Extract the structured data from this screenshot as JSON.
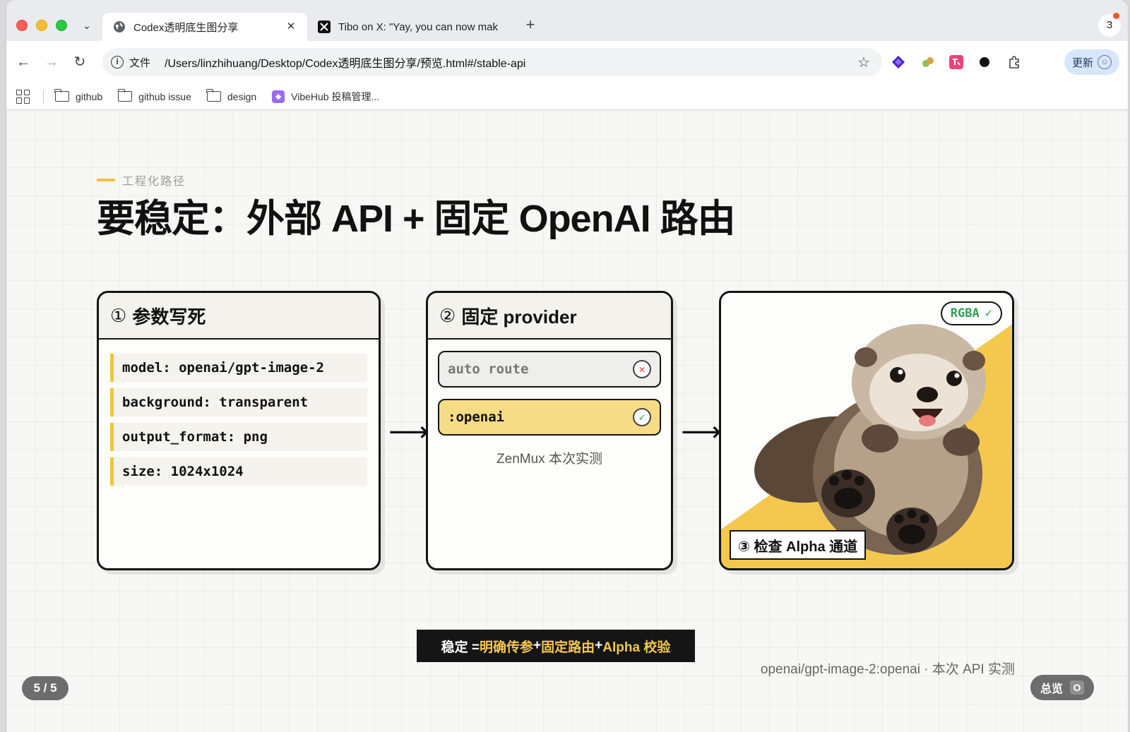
{
  "browser": {
    "tabs": [
      {
        "title": "Codex透明底生图分享",
        "active": true
      },
      {
        "title": "Tibo on X: \"Yay, you can now mak",
        "active": false
      }
    ],
    "tab_close": "✕",
    "new_tab": "+",
    "tab_count": "3",
    "address": {
      "scheme": "文件",
      "url": "/Users/linzhihuang/Desktop/Codex透明底生图分享/预览.html#/stable-api"
    },
    "update_label": "更新",
    "bookmarks": [
      "github",
      "github issue",
      "design",
      "VibeHub 投稿管理..."
    ]
  },
  "slide": {
    "eyebrow": "工程化路径",
    "headline": "要稳定：外部 API + 固定 OpenAI 路由",
    "card1": {
      "num": "①",
      "title": "参数写死",
      "params": [
        "model: openai/gpt-image-2",
        "background: transparent",
        "output_format: png",
        "size: 1024x1024"
      ]
    },
    "card2": {
      "num": "②",
      "title": "固定 provider",
      "routes": [
        {
          "label": "auto route",
          "status": "rejected"
        },
        {
          "label": ":openai",
          "status": "selected"
        }
      ],
      "note": "ZenMux 本次实测"
    },
    "card3": {
      "badge": "RGBA",
      "badge_check": "✓",
      "label": "③ 检查 Alpha 通道"
    },
    "arrow": "⟶",
    "formula": {
      "prefix": "稳定 = ",
      "part1": "明确传参",
      "plus1": " + ",
      "part2": "固定路由",
      "plus2": " + ",
      "part3": "Alpha 校验"
    },
    "caption": "openai/gpt-image-2:openai · 本次 API 实测",
    "pager": "5 / 5",
    "overview": {
      "label": "总览",
      "key": "O"
    }
  },
  "colors": {
    "accent": "#f4c84f",
    "ok": "#2f9e54",
    "error": "#e0413b",
    "ink": "#141414"
  }
}
